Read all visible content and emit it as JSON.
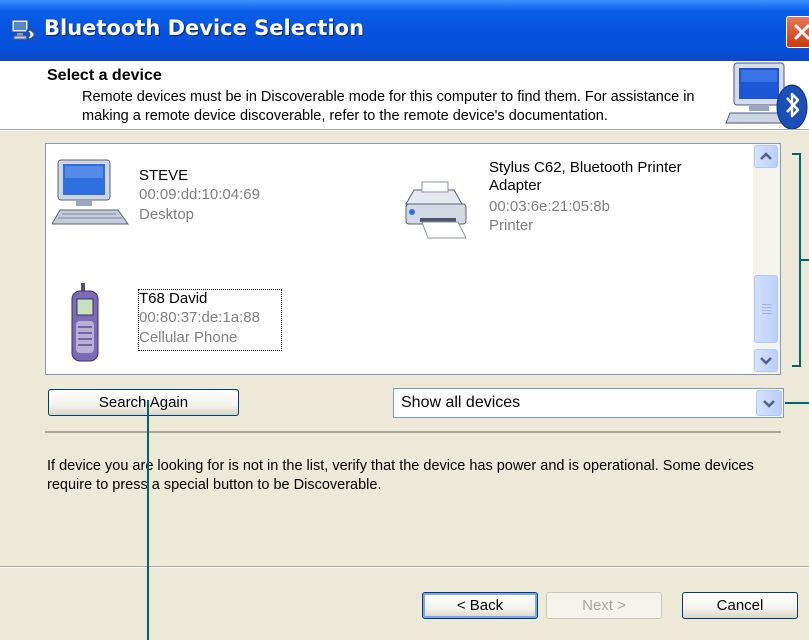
{
  "window": {
    "title": "Bluetooth Device Selection"
  },
  "header": {
    "title": "Select a device",
    "description": "Remote devices must be in Discoverable mode for this computer to find them. For assistance in making a remote device discoverable, refer to the remote device's documentation.",
    "icon": "computer-bluetooth-icon"
  },
  "devices": [
    {
      "name": "STEVE",
      "address": "00:09:dd:10:04:69",
      "type": "Desktop",
      "icon": "desktop-computer-icon"
    },
    {
      "name": "Stylus C62, Bluetooth Printer Adapter",
      "address": "00:03:6e:21:05:8b",
      "type": "Printer",
      "icon": "printer-icon"
    },
    {
      "name": "T68 David",
      "address": "00:80:37:de:1a:88",
      "type": "Cellular Phone",
      "icon": "cellular-phone-icon",
      "focused": true
    }
  ],
  "controls": {
    "search_again_label": "Search Again",
    "filter_selected": "Show all devices"
  },
  "info_text": "If device you are looking for is not in the list, verify that the device has power and is operational. Some devices require to press a special button to be Discoverable.",
  "footer": {
    "back_label": "< Back",
    "next_label": "Next >",
    "next_enabled": false,
    "cancel_label": "Cancel"
  },
  "colors": {
    "titlebar": "#0553df",
    "callout_lines": "#006666",
    "close_button": "#c8380f"
  }
}
